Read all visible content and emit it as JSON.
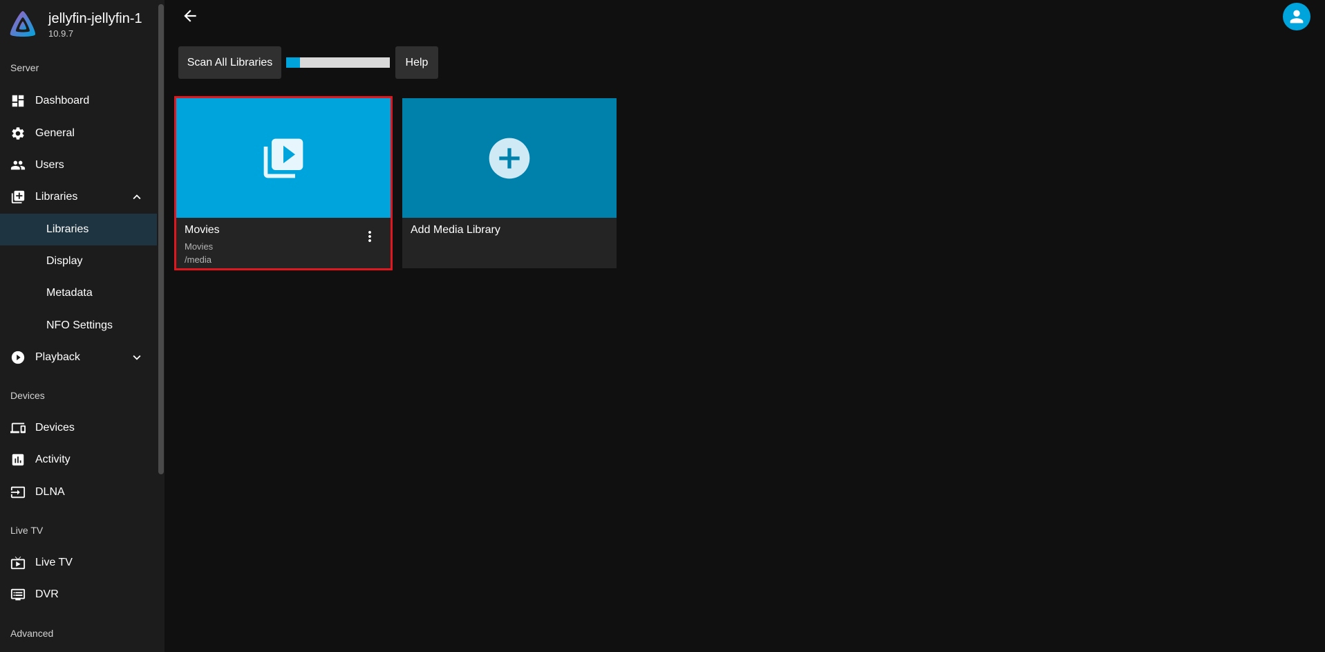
{
  "app": {
    "server_name": "jellyfin-jellyfin-1",
    "version": "10.9.7"
  },
  "sidebar": {
    "sections": {
      "server": "Server",
      "devices": "Devices",
      "live_tv": "Live TV",
      "advanced": "Advanced"
    },
    "items": {
      "dashboard": "Dashboard",
      "general": "General",
      "users": "Users",
      "libraries": "Libraries",
      "playback": "Playback",
      "devices": "Devices",
      "activity": "Activity",
      "dlna": "DLNA",
      "live_tv": "Live TV",
      "dvr": "DVR"
    },
    "library_subitems": {
      "libraries": "Libraries",
      "display": "Display",
      "metadata": "Metadata",
      "nfo_settings": "NFO Settings"
    }
  },
  "toolbar": {
    "scan_label": "Scan All Libraries",
    "help_label": "Help",
    "scan_progress": 0.13
  },
  "libraries": {
    "movies": {
      "title": "Movies",
      "type": "Movies",
      "path": "/media"
    },
    "add": {
      "title": "Add Media Library"
    }
  },
  "colors": {
    "accent": "#00a4dc",
    "add_card": "#0081ab",
    "selection": "#e0171f",
    "active_nav": "#1e3440"
  }
}
